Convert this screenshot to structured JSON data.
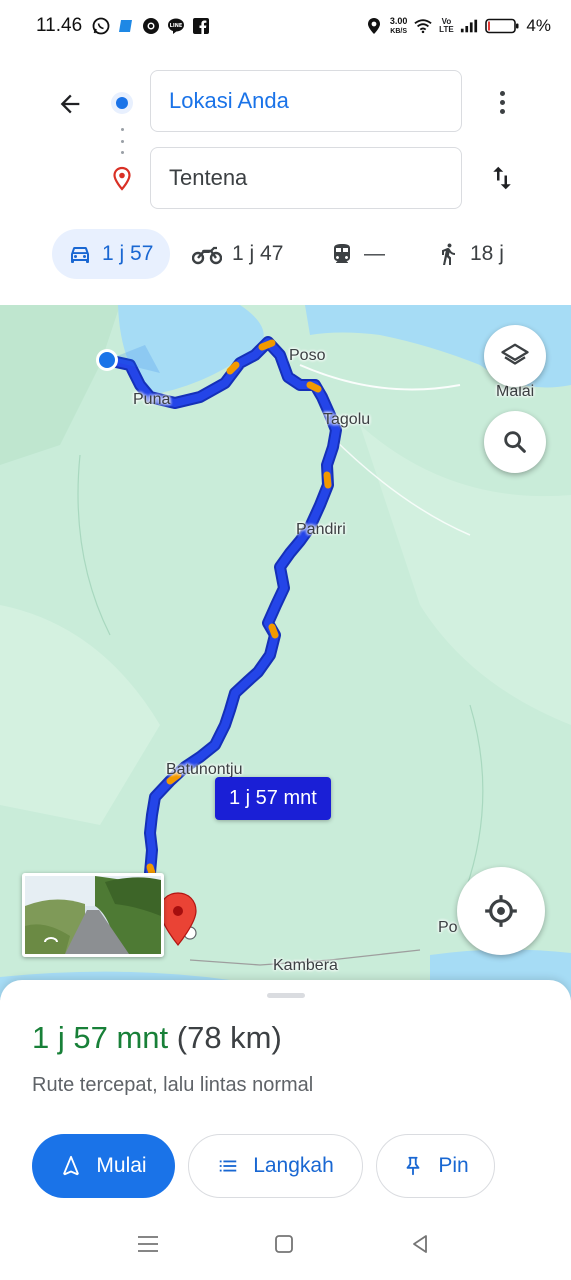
{
  "status_bar": {
    "time": "11.46",
    "net_speed_value": "3.00",
    "net_speed_unit": "KB/S",
    "volte": "Vo LTE",
    "battery": "4%"
  },
  "header": {
    "origin": "Lokasi Anda",
    "destination": "Tentena"
  },
  "modes": {
    "drive": "1 j 57",
    "motorcycle": "1 j 47",
    "transit": "—",
    "walk": "18 j"
  },
  "map": {
    "labels": {
      "poso": "Poso",
      "malai": "Malai",
      "puna": "Puna",
      "tagolu": "Tagolu",
      "pandiri": "Pandiri",
      "batunontju": "Batunontju",
      "kambera": "Kambera",
      "po": "Po"
    },
    "route_chip": "1 j 57 mnt",
    "colors": {
      "route": "#2445e8",
      "route_outline": "#1530b8",
      "traffic": "#f29900",
      "land": "#c9ecd9",
      "water": "#a6dcf5"
    }
  },
  "sheet": {
    "duration": "1 j 57 mnt",
    "distance": "(78 km)",
    "subtitle": "Rute tercepat, lalu lintas normal",
    "start_label": "Mulai",
    "steps_label": "Langkah",
    "pin_label": "Pin"
  }
}
